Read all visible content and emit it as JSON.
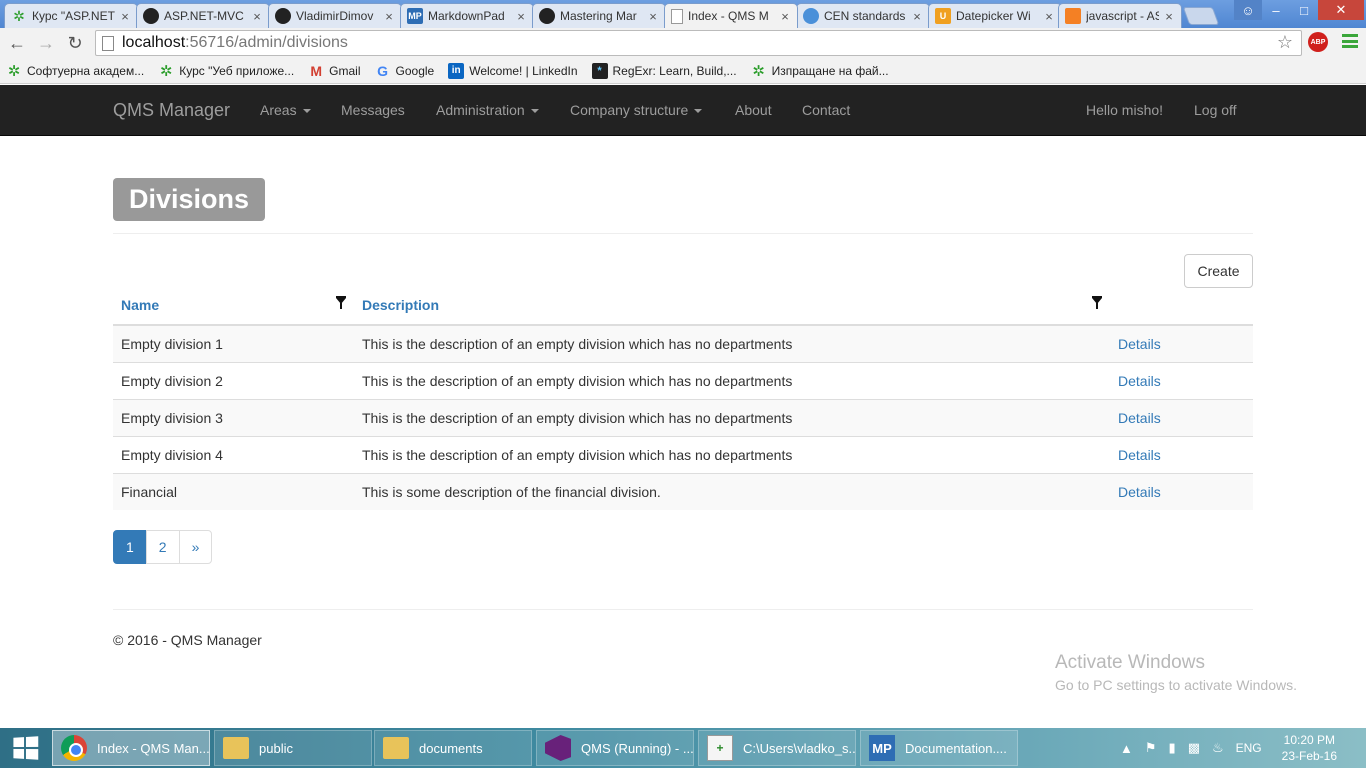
{
  "browser": {
    "tabs": [
      {
        "title": "Курс \"ASP.NET",
        "favicon": "telerik-academy-icon",
        "active": false
      },
      {
        "title": "ASP.NET-MVC",
        "favicon": "github-icon",
        "active": false
      },
      {
        "title": "VladimirDimov",
        "favicon": "github-icon",
        "active": false
      },
      {
        "title": "MarkdownPad",
        "favicon": "markdownpad-icon",
        "active": false
      },
      {
        "title": "Mastering Mar",
        "favicon": "github-icon",
        "active": false
      },
      {
        "title": "Index - QMS M",
        "favicon": "page-icon",
        "active": true
      },
      {
        "title": "CEN standards",
        "favicon": "cen-icon",
        "active": false
      },
      {
        "title": "Datepicker Wi",
        "favicon": "datepicker-icon",
        "active": false
      },
      {
        "title": "javascript - AS",
        "favicon": "stackoverflow-icon",
        "active": false
      }
    ],
    "url_host": "localhost",
    "url_path": ":56716/admin/divisions",
    "abp_label": "ABP",
    "bookmarks": [
      {
        "label": "Софтуерна академ...",
        "icon": "telerik-academy-icon"
      },
      {
        "label": "Курс \"Уеб приложе...",
        "icon": "telerik-academy-icon"
      },
      {
        "label": "Gmail",
        "icon": "gmail-icon"
      },
      {
        "label": "Google",
        "icon": "google-icon"
      },
      {
        "label": "Welcome! | LinkedIn",
        "icon": "linkedin-icon"
      },
      {
        "label": "RegExr: Learn, Build,...",
        "icon": "regexr-icon"
      },
      {
        "label": "Изпращане на фай...",
        "icon": "telerik-academy-icon"
      }
    ]
  },
  "navbar": {
    "brand": "QMS Manager",
    "items": [
      {
        "label": "Areas",
        "dropdown": true
      },
      {
        "label": "Messages",
        "dropdown": false
      },
      {
        "label": "Administration",
        "dropdown": true
      },
      {
        "label": "Company structure",
        "dropdown": true
      },
      {
        "label": "About",
        "dropdown": false
      },
      {
        "label": "Contact",
        "dropdown": false
      }
    ],
    "greeting": "Hello misho!",
    "logoff": "Log off"
  },
  "page": {
    "title": "Divisions",
    "create_label": "Create",
    "table": {
      "columns": [
        "Name",
        "Description"
      ],
      "rows": [
        {
          "name": "Empty division 1",
          "description": "This is the description of an empty division which has no departments",
          "action": "Details"
        },
        {
          "name": "Empty division 2",
          "description": "This is the description of an empty division which has no departments",
          "action": "Details"
        },
        {
          "name": "Empty division 3",
          "description": "This is the description of an empty division which has no departments",
          "action": "Details"
        },
        {
          "name": "Empty division 4",
          "description": "This is the description of an empty division which has no departments",
          "action": "Details"
        },
        {
          "name": "Financial",
          "description": "This is some description of the financial division.",
          "action": "Details"
        }
      ]
    },
    "pager": {
      "pages": [
        "1",
        "2",
        "»"
      ],
      "current": "1"
    },
    "footer": "© 2016 - QMS Manager"
  },
  "watermark": {
    "title": "Activate Windows",
    "subtitle": "Go to PC settings to activate Windows."
  },
  "taskbar": {
    "items": [
      {
        "label": "Index - QMS Man...",
        "icon": "chrome-icon",
        "active": true
      },
      {
        "label": "public",
        "icon": "folder-icon",
        "active": false
      },
      {
        "label": "documents",
        "icon": "folder-icon",
        "active": false
      },
      {
        "label": "QMS (Running) - ...",
        "icon": "visual-studio-icon",
        "active": false
      },
      {
        "label": "C:\\Users\\vladko_s...",
        "icon": "notepad-plus-icon",
        "active": false
      },
      {
        "label": "Documentation....",
        "icon": "markdownpad-icon",
        "active": false
      }
    ],
    "language": "ENG",
    "time": "10:20 PM",
    "date": "23-Feb-16"
  },
  "colors": {
    "navbar_bg": "#222222",
    "link": "#337ab7",
    "title_badge_bg": "#999999",
    "tab_strip": "#4f86d2"
  }
}
